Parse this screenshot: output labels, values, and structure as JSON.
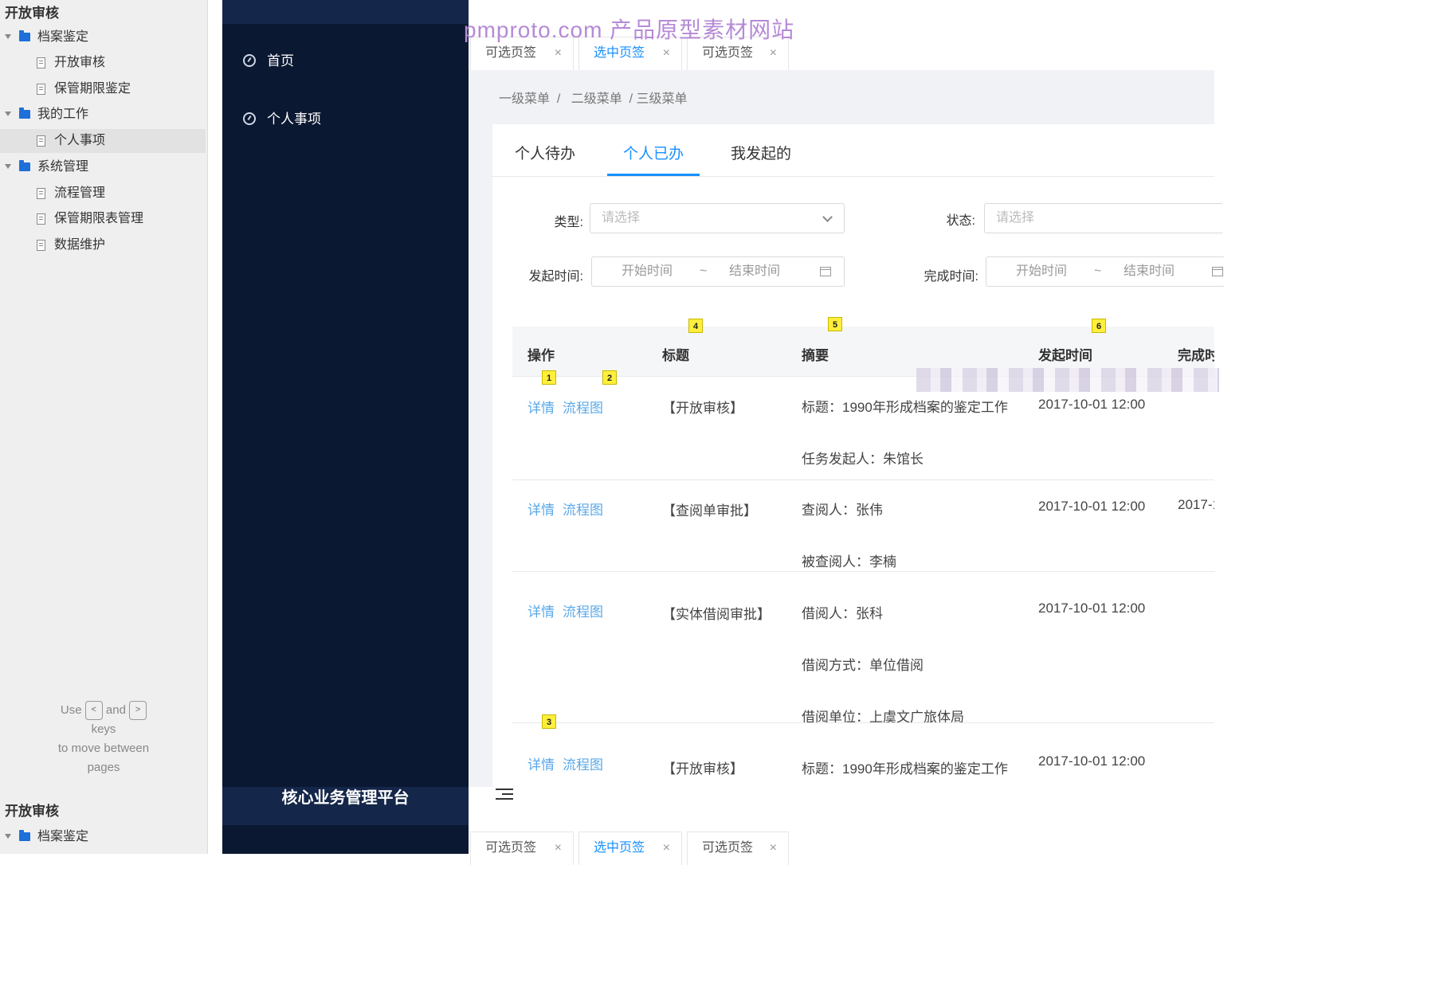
{
  "tree": {
    "title": "开放审核",
    "nodes": [
      {
        "label": "档案鉴定",
        "type": "folder"
      },
      {
        "label": "开放审核",
        "type": "page"
      },
      {
        "label": "保管期限鉴定",
        "type": "page"
      },
      {
        "label": "我的工作",
        "type": "folder"
      },
      {
        "label": "个人事项",
        "type": "page",
        "selected": true
      },
      {
        "label": "系统管理",
        "type": "folder"
      },
      {
        "label": "流程管理",
        "type": "page"
      },
      {
        "label": "保管期限表管理",
        "type": "page"
      },
      {
        "label": "数据维护",
        "type": "page"
      }
    ],
    "hint": {
      "use": "Use",
      "and": "and",
      "keys": "keys",
      "line2": "to move between",
      "line3": "pages",
      "prev_key": "<",
      "next_key": ">"
    },
    "bottom_title": "开放审核",
    "bottom_node": "档案鉴定"
  },
  "nav": {
    "items": [
      {
        "label": "首页",
        "icon": "dashboard-icon"
      },
      {
        "label": "个人事项",
        "icon": "dashboard-icon"
      }
    ],
    "bottom_title": "核心业务管理平台"
  },
  "watermark": "pmproto.com 产品原型素材网站",
  "tabs": [
    {
      "label": "可选页签",
      "active": false
    },
    {
      "label": "选中页签",
      "active": true
    },
    {
      "label": "可选页签",
      "active": false
    }
  ],
  "breadcrumb": {
    "l1": "一级菜单",
    "sep": "/",
    "l2": "二级菜单",
    "l3": "/ 三级菜单"
  },
  "content_tabs": [
    {
      "label": "个人待办",
      "active": false
    },
    {
      "label": "个人已办",
      "active": true
    },
    {
      "label": "我发起的",
      "active": false
    }
  ],
  "filters": {
    "type_label": "类型:",
    "type_placeholder": "请选择",
    "status_label": "状态:",
    "status_placeholder": "请选择",
    "start_label": "发起时间:",
    "finish_label": "完成时间:",
    "range_start": "开始时间",
    "range_sep": "~",
    "range_end": "结束时间"
  },
  "table": {
    "columns": [
      "操作",
      "标题",
      "摘要",
      "发起时间",
      "完成时"
    ],
    "detail_link": "详情",
    "flow_link": "流程图",
    "rows": [
      {
        "title": "【开放审核】",
        "summary": [
          "标题：1990年形成档案的鉴定工作",
          "任务发起人：朱馆长"
        ],
        "start": "2017-10-01 12:00",
        "finish": ""
      },
      {
        "title": "【查阅单审批】",
        "summary": [
          "查阅人：张伟",
          "被查阅人：李楠"
        ],
        "start": "2017-10-01 12:00",
        "finish": "2017-1"
      },
      {
        "title": "【实体借阅审批】",
        "summary": [
          "借阅人：张科",
          "借阅方式：单位借阅",
          "借阅单位：上虞文广旅体局"
        ],
        "start": "2017-10-01 12:00",
        "finish": ""
      },
      {
        "title": "【开放审核】",
        "summary": [
          "标题：1990年形成档案的鉴定工作"
        ],
        "start": "2017-10-01 12:00",
        "finish": ""
      }
    ],
    "badges": [
      "1",
      "2",
      "3",
      "4",
      "5",
      "6"
    ]
  },
  "colors": {
    "primary": "#1890ff",
    "link": "#5aa8e8",
    "nav_bg": "#0b1832",
    "nav_header": "#142649",
    "badge": "#ffef3a"
  }
}
